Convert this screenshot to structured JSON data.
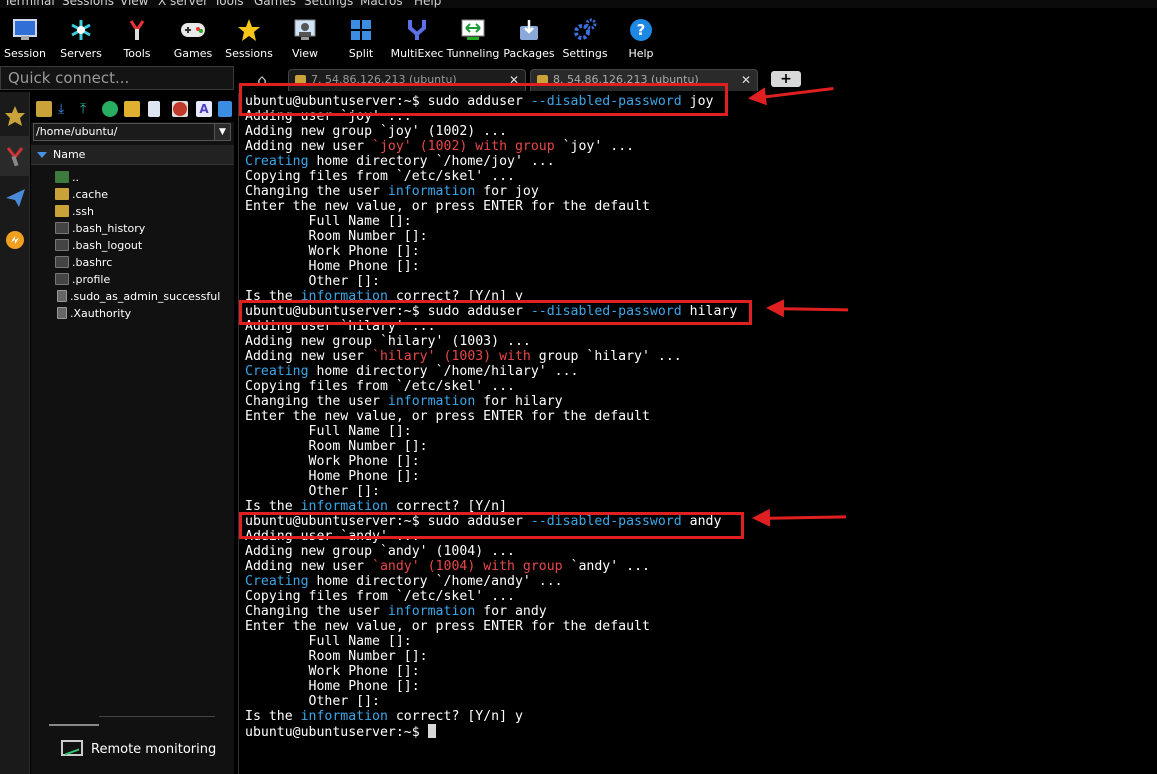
{
  "menubar": [
    "Terminal",
    "Sessions",
    "View",
    "X server",
    "Tools",
    "Games",
    "Settings",
    "Macros",
    "Help"
  ],
  "toolbar": [
    {
      "label": "Session",
      "icon": "session-icon"
    },
    {
      "label": "Servers",
      "icon": "servers-icon"
    },
    {
      "label": "Tools",
      "icon": "tools-icon"
    },
    {
      "label": "Games",
      "icon": "games-icon"
    },
    {
      "label": "Sessions",
      "icon": "sessions-star-icon"
    },
    {
      "label": "View",
      "icon": "view-icon"
    },
    {
      "label": "Split",
      "icon": "split-icon"
    },
    {
      "label": "MultiExec",
      "icon": "multiexec-icon"
    },
    {
      "label": "Tunneling",
      "icon": "tunneling-icon"
    },
    {
      "label": "Packages",
      "icon": "packages-icon"
    },
    {
      "label": "Settings",
      "icon": "settings-icon"
    },
    {
      "label": "Help",
      "icon": "help-icon"
    }
  ],
  "quick_connect": {
    "placeholder": "Quick connect..."
  },
  "file_browser": {
    "path": "/home/ubuntu/",
    "column_header": "Name",
    "items": [
      {
        "name": "..",
        "type": "up"
      },
      {
        "name": ".cache",
        "type": "folder"
      },
      {
        "name": ".ssh",
        "type": "folder"
      },
      {
        "name": ".bash_history",
        "type": "file"
      },
      {
        "name": ".bash_logout",
        "type": "file"
      },
      {
        "name": ".bashrc",
        "type": "file"
      },
      {
        "name": ".profile",
        "type": "file"
      },
      {
        "name": ".sudo_as_admin_successful",
        "type": "doc"
      },
      {
        "name": ".Xauthority",
        "type": "doc"
      }
    ],
    "remote_monitoring": "Remote monitoring"
  },
  "tabs": [
    {
      "label": "7. 54.86.126.213 (ubuntu)",
      "active": false
    },
    {
      "label": "8. 54.86.126.213 (ubuntu)",
      "active": true
    }
  ],
  "terminal": {
    "prompt": "ubuntu@ubuntuserver:~$ ",
    "lines": [
      [
        {
          "t": "ubuntu@ubuntuserver:~$ sudo adduser "
        },
        {
          "t": "--disabled-password",
          "c": "blue"
        },
        {
          "t": " joy"
        }
      ],
      [
        {
          "t": "Adding user `joy' ..."
        }
      ],
      [
        {
          "t": "Adding new group `joy' (1002) ..."
        }
      ],
      [
        {
          "t": "Adding new user "
        },
        {
          "t": "`joy' (1002) with group",
          "c": "red"
        },
        {
          "t": " `joy' ..."
        }
      ],
      [
        {
          "t": "Creating",
          "c": "blue"
        },
        {
          "t": " home directory `/home/joy' ..."
        }
      ],
      [
        {
          "t": "Copying files from `/etc/skel' ..."
        }
      ],
      [
        {
          "t": "Changing the user "
        },
        {
          "t": "information",
          "c": "blue"
        },
        {
          "t": " for joy"
        }
      ],
      [
        {
          "t": "Enter the new value, or press ENTER for the default"
        }
      ],
      [
        {
          "t": "        Full Name []:"
        }
      ],
      [
        {
          "t": "        Room Number []:"
        }
      ],
      [
        {
          "t": "        Work Phone []:"
        }
      ],
      [
        {
          "t": "        Home Phone []:"
        }
      ],
      [
        {
          "t": "        Other []:"
        }
      ],
      [
        {
          "t": "Is the "
        },
        {
          "t": "information",
          "c": "blue"
        },
        {
          "t": " correct? [Y/n] y"
        }
      ],
      [
        {
          "t": "ubuntu@ubuntuserver:~$ sudo adduser "
        },
        {
          "t": "--disabled-password",
          "c": "blue"
        },
        {
          "t": " hilary"
        }
      ],
      [
        {
          "t": "Adding user `hilary' ..."
        }
      ],
      [
        {
          "t": "Adding new group `hilary' (1003) ..."
        }
      ],
      [
        {
          "t": "Adding new user "
        },
        {
          "t": "`hilary' (1003) with",
          "c": "red"
        },
        {
          "t": " group `hilary' ..."
        }
      ],
      [
        {
          "t": "Creating",
          "c": "blue"
        },
        {
          "t": " home directory `/home/hilary' ..."
        }
      ],
      [
        {
          "t": "Copying files from `/etc/skel' ..."
        }
      ],
      [
        {
          "t": "Changing the user "
        },
        {
          "t": "information",
          "c": "blue"
        },
        {
          "t": " for hilary"
        }
      ],
      [
        {
          "t": "Enter the new value, or press ENTER for the default"
        }
      ],
      [
        {
          "t": "        Full Name []:"
        }
      ],
      [
        {
          "t": "        Room Number []:"
        }
      ],
      [
        {
          "t": "        Work Phone []:"
        }
      ],
      [
        {
          "t": "        Home Phone []:"
        }
      ],
      [
        {
          "t": "        Other []:"
        }
      ],
      [
        {
          "t": "Is the "
        },
        {
          "t": "information",
          "c": "blue"
        },
        {
          "t": " correct? [Y/n]"
        }
      ],
      [
        {
          "t": "ubuntu@ubuntuserver:~$ sudo adduser "
        },
        {
          "t": "--disabled-password",
          "c": "blue"
        },
        {
          "t": " andy"
        }
      ],
      [
        {
          "t": "Adding user `andy' ..."
        }
      ],
      [
        {
          "t": "Adding new group `andy' (1004) ..."
        }
      ],
      [
        {
          "t": "Adding new user "
        },
        {
          "t": "`andy' (1004) with group",
          "c": "red"
        },
        {
          "t": " `andy' ..."
        }
      ],
      [
        {
          "t": "Creating",
          "c": "blue"
        },
        {
          "t": " home directory `/home/andy' ..."
        }
      ],
      [
        {
          "t": "Copying files from `/etc/skel' ..."
        }
      ],
      [
        {
          "t": "Changing the user "
        },
        {
          "t": "information",
          "c": "blue"
        },
        {
          "t": " for andy"
        }
      ],
      [
        {
          "t": "Enter the new value, or press ENTER for the default"
        }
      ],
      [
        {
          "t": "        Full Name []:"
        }
      ],
      [
        {
          "t": "        Room Number []:"
        }
      ],
      [
        {
          "t": "        Work Phone []:"
        }
      ],
      [
        {
          "t": "        Home Phone []:"
        }
      ],
      [
        {
          "t": "        Other []:"
        }
      ],
      [
        {
          "t": "Is the "
        },
        {
          "t": "information",
          "c": "blue"
        },
        {
          "t": " correct? [Y/n] y"
        }
      ],
      [
        {
          "t": "ubuntu@ubuntuserver:~$ "
        },
        {
          "cursor": true
        }
      ]
    ]
  },
  "colors": {
    "accent_blue": "#3aa7e8",
    "accent_red": "#e9474b",
    "highlight_red": "#e02020"
  }
}
